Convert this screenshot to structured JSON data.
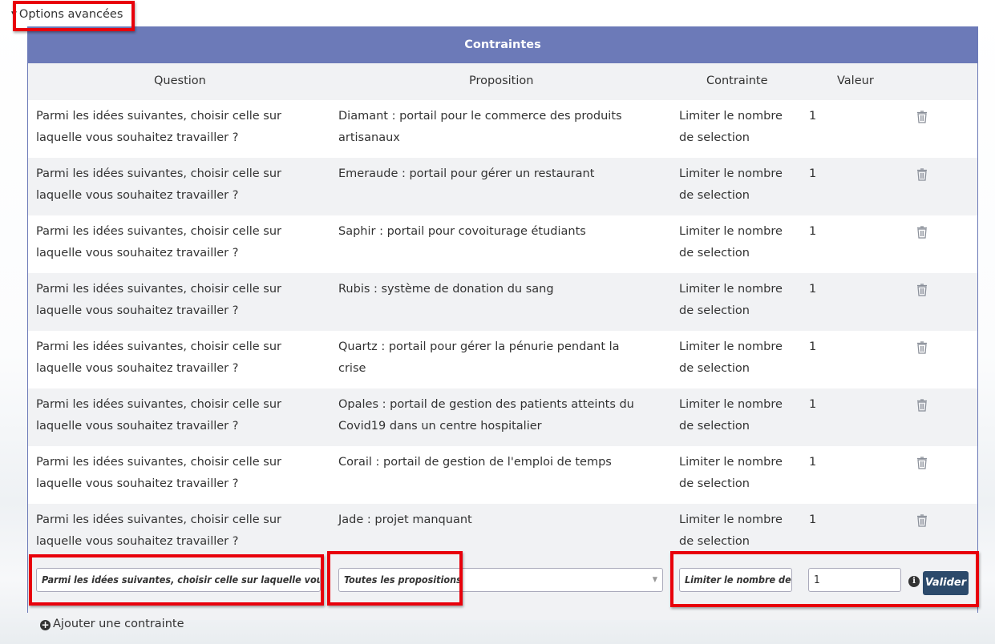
{
  "advanced_toggle": {
    "label": "Options avancées"
  },
  "panel": {
    "title": "Contraintes",
    "columns": {
      "question": "Question",
      "proposition": "Proposition",
      "contrainte": "Contrainte",
      "valeur": "Valeur"
    }
  },
  "rows": [
    {
      "question": "Parmi les idées suivantes, choisir celle sur laquelle vous souhaitez travailler ?",
      "proposition": "Diamant : portail pour le commerce des produits artisanaux",
      "contrainte": "Limiter le nombre de selection",
      "valeur": "1"
    },
    {
      "question": "Parmi les idées suivantes, choisir celle sur laquelle vous souhaitez travailler ?",
      "proposition": "Emeraude : portail pour gérer un restaurant",
      "contrainte": "Limiter le nombre de selection",
      "valeur": "1"
    },
    {
      "question": "Parmi les idées suivantes, choisir celle sur laquelle vous souhaitez travailler ?",
      "proposition": "Saphir : portail pour covoiturage étudiants",
      "contrainte": "Limiter le nombre de selection",
      "valeur": "1"
    },
    {
      "question": "Parmi les idées suivantes, choisir celle sur laquelle vous souhaitez travailler ?",
      "proposition": "Rubis : système de donation du sang",
      "contrainte": "Limiter le nombre de selection",
      "valeur": "1"
    },
    {
      "question": "Parmi les idées suivantes, choisir celle sur laquelle vous souhaitez travailler ?",
      "proposition": "Quartz : portail pour gérer la pénurie pendant la crise",
      "contrainte": "Limiter le nombre de selection",
      "valeur": "1"
    },
    {
      "question": "Parmi les idées suivantes, choisir celle sur laquelle vous souhaitez travailler ?",
      "proposition": "Opales : portail de gestion des patients atteints du Covid19 dans un centre hospitalier",
      "contrainte": "Limiter le nombre de selection",
      "valeur": "1"
    },
    {
      "question": "Parmi les idées suivantes, choisir celle sur laquelle vous souhaitez travailler ?",
      "proposition": "Corail : portail de gestion de l'emploi de temps",
      "contrainte": "Limiter le nombre de selection",
      "valeur": "1"
    },
    {
      "question": "Parmi les idées suivantes, choisir celle sur laquelle vous souhaitez travailler ?",
      "proposition": "Jade : projet manquant",
      "contrainte": "Limiter le nombre de selection",
      "valeur": "1"
    }
  ],
  "form": {
    "question_value": "Parmi les idées suivantes, choisir celle sur laquelle vous souhaitez travailler ?",
    "proposition_selected": "Toutes les propositions",
    "contrainte_value": "Limiter le nombre de selection",
    "valeur_value": "1",
    "submit_label": "Valider"
  },
  "add_constraint": {
    "label": "Ajouter une contrainte"
  },
  "icons": {
    "delete": "trash-icon",
    "info": "info-icon",
    "add": "plus-circle-icon",
    "toggle": "caret-down-icon"
  },
  "colors": {
    "header": "#6c7ab8",
    "button": "#2c4a6b",
    "highlight": "#e8000b"
  }
}
